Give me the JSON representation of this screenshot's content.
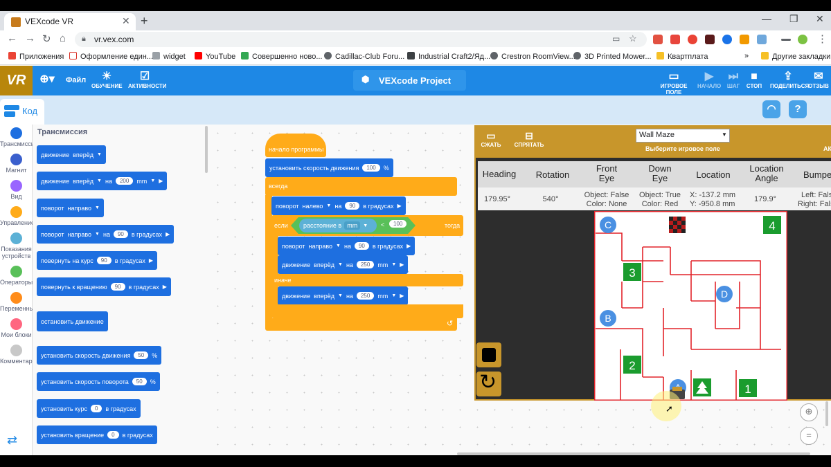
{
  "browser": {
    "tab_title": "VEXcode VR",
    "url": "vr.vex.com",
    "tab_close": "✕",
    "new_tab": "+",
    "window_controls": [
      "—",
      "❐",
      "✕"
    ],
    "bookmarks": [
      {
        "label": "Приложения",
        "color": "#ea4335"
      },
      {
        "label": "Оформление един...",
        "color": "#d93025"
      },
      {
        "label": "widget",
        "color": "#9aa0a6"
      },
      {
        "label": "YouTube",
        "color": "#ff0000"
      },
      {
        "label": "Совершенно ново...",
        "color": "#34a853"
      },
      {
        "label": "Cadillac-Club Foru...",
        "color": "#5f6368"
      },
      {
        "label": "Industrial Craft2/Яд...",
        "color": "#3c4043"
      },
      {
        "label": "Crestron RoomView...",
        "color": "#5f6368"
      },
      {
        "label": "3D Printed Mower...",
        "color": "#5f6368"
      },
      {
        "label": "Квартплата",
        "color": "#f6c026"
      }
    ],
    "bookmarks_more": "»",
    "other_bookmarks": "Другие закладки"
  },
  "appbar": {
    "logo": "VR",
    "file": "Файл",
    "learn": "ОБУЧЕНИЕ",
    "activities": "АКТИВНОСТИ",
    "project": "VEXcode Project",
    "playground": "ИГРОВОЕ ПОЛЕ",
    "start": "НАЧАЛО",
    "step": "ШАГ",
    "stop": "СТОП",
    "share": "ПОДЕЛИТЬСЯ",
    "feedback": "ОТЗЫВ"
  },
  "code_tab": "Код",
  "categories": [
    {
      "label": "Трансмиссия",
      "color": "#1e6fe0"
    },
    {
      "label": "Магнит",
      "color": "#3a5fcd"
    },
    {
      "label": "Вид",
      "color": "#9966ff"
    },
    {
      "label": "Управление",
      "color": "#ffab19"
    },
    {
      "label": "Показания устройств",
      "color": "#5cb1d6"
    },
    {
      "label": "Операторы",
      "color": "#59c059"
    },
    {
      "label": "Переменные",
      "color": "#ff8c1a"
    },
    {
      "label": "Мои блоки",
      "color": "#ff6680"
    },
    {
      "label": "Комментарий",
      "color": "#c8c8c8"
    }
  ],
  "flyout": {
    "title": "Трансмиссия",
    "drive": "движение",
    "forward": "вперёд",
    "on": "на",
    "mm": "mm",
    "turn": "поворот",
    "right": "направо",
    "in_degrees": "в градусах",
    "turn_to_heading": "повернуть на курс",
    "turn_to_rotation": "повернуть к вращению",
    "stop_driving": "остановить движение",
    "set_drive_velocity": "установить скорость движения",
    "set_turn_velocity": "установить скорость поворота",
    "set_heading": "установить курс",
    "set_rotation": "установить вращение",
    "percent": "%",
    "v200": "200",
    "v90": "90",
    "v50": "50",
    "v0": "0"
  },
  "program": {
    "hat": "начало программы",
    "set_velocity": "установить скорость движения",
    "velocity": "100",
    "percent": "%",
    "forever": "всегда",
    "turn": "поворот",
    "left": "налево",
    "right": "направо",
    "on": "на",
    "deg": "90",
    "in_degrees": "в градусах",
    "if": "если",
    "distance": "расстояние в",
    "unit": "mm",
    "lt": "<",
    "threshold": "100",
    "then": "тогда",
    "drive": "движение",
    "forward": "вперёд",
    "dist": "250",
    "mm": "mm",
    "else": "иначе"
  },
  "game": {
    "shrink": "СЖАТЬ",
    "hide": "СПРЯТАТЬ",
    "world": "Wall Maze",
    "world_hint": "Выберите игровое поле",
    "headers": [
      "Heading",
      "Rotation",
      "Front\nEye",
      "Down\nEye",
      "Location",
      "Location\nAngle",
      "Bumpe"
    ],
    "values": {
      "heading": "179.95°",
      "rotation": "540°",
      "front_eye_1": "Object: False",
      "front_eye_2": "Color: None",
      "down_eye_1": "Object: True",
      "down_eye_2": "Color: Red",
      "loc_x": "X: -137.2 mm",
      "loc_y": "Y: -950.8 mm",
      "loc_angle": "179.9°",
      "bump_left": "Left: Fals",
      "bump_right": "Right: Fals"
    },
    "maze_letters": [
      "A",
      "B",
      "C",
      "D"
    ],
    "maze_numbers": [
      "1",
      "2",
      "3",
      "4"
    ],
    "colors": {
      "gold": "#c8962b",
      "wall": "#e2232a",
      "tile": "#1a9c2e",
      "letter": "#4a90e2"
    }
  }
}
